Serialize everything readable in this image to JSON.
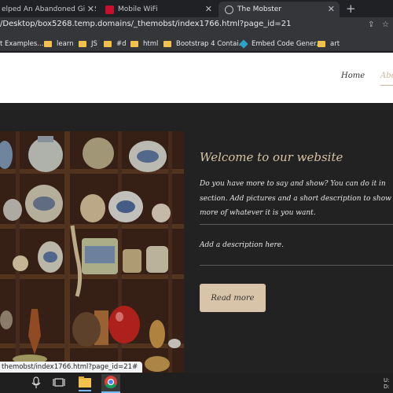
{
  "browser": {
    "tabs": [
      {
        "title": "elped An Abandoned Girl. She",
        "active": false
      },
      {
        "title": "Mobile WiFi",
        "active": false
      },
      {
        "title": "The Mobster",
        "active": true
      }
    ],
    "new_tab": "+",
    "close_glyph": "✕",
    "url": "/Desktop/box5268.temp.domains/_themobst/index1766.html?page_id=21",
    "toolbar_icons": [
      "share-icon",
      "bookmark-star-icon"
    ],
    "bookmarks": [
      {
        "label": "t Examples...",
        "icon": "folder-icon"
      },
      {
        "label": "learn",
        "icon": "folder-icon"
      },
      {
        "label": "JS",
        "icon": "folder-icon"
      },
      {
        "label": "#d",
        "icon": "folder-icon"
      },
      {
        "label": "html",
        "icon": "folder-icon"
      },
      {
        "label": "Bootstrap 4 Contai...",
        "icon": "bootstrap-icon"
      },
      {
        "label": "Embed Code Gener...",
        "icon": "diamond-icon"
      },
      {
        "label": "art",
        "icon": "folder-icon"
      }
    ]
  },
  "site": {
    "nav": {
      "home": "Home",
      "about": "Abo"
    },
    "section": {
      "heading": "Welcome to our website",
      "body_lines": [
        "Do you have more to say and show? You can do it in",
        "section. Add pictures and a short description to show vi",
        "more of whatever it is you want."
      ],
      "description": "Add a description here.",
      "button": "Read more"
    },
    "colors": {
      "accent": "#d8c4a8",
      "background": "#222222",
      "heading": "#d6c3a6"
    }
  },
  "status_url": "themobst/index1766.html?page_id=21#",
  "taskbar": {
    "apps": [
      "microphone-icon",
      "task-view-icon",
      "file-explorer-icon",
      "chrome-icon"
    ],
    "tray_lines": [
      "U:",
      "D:"
    ]
  }
}
